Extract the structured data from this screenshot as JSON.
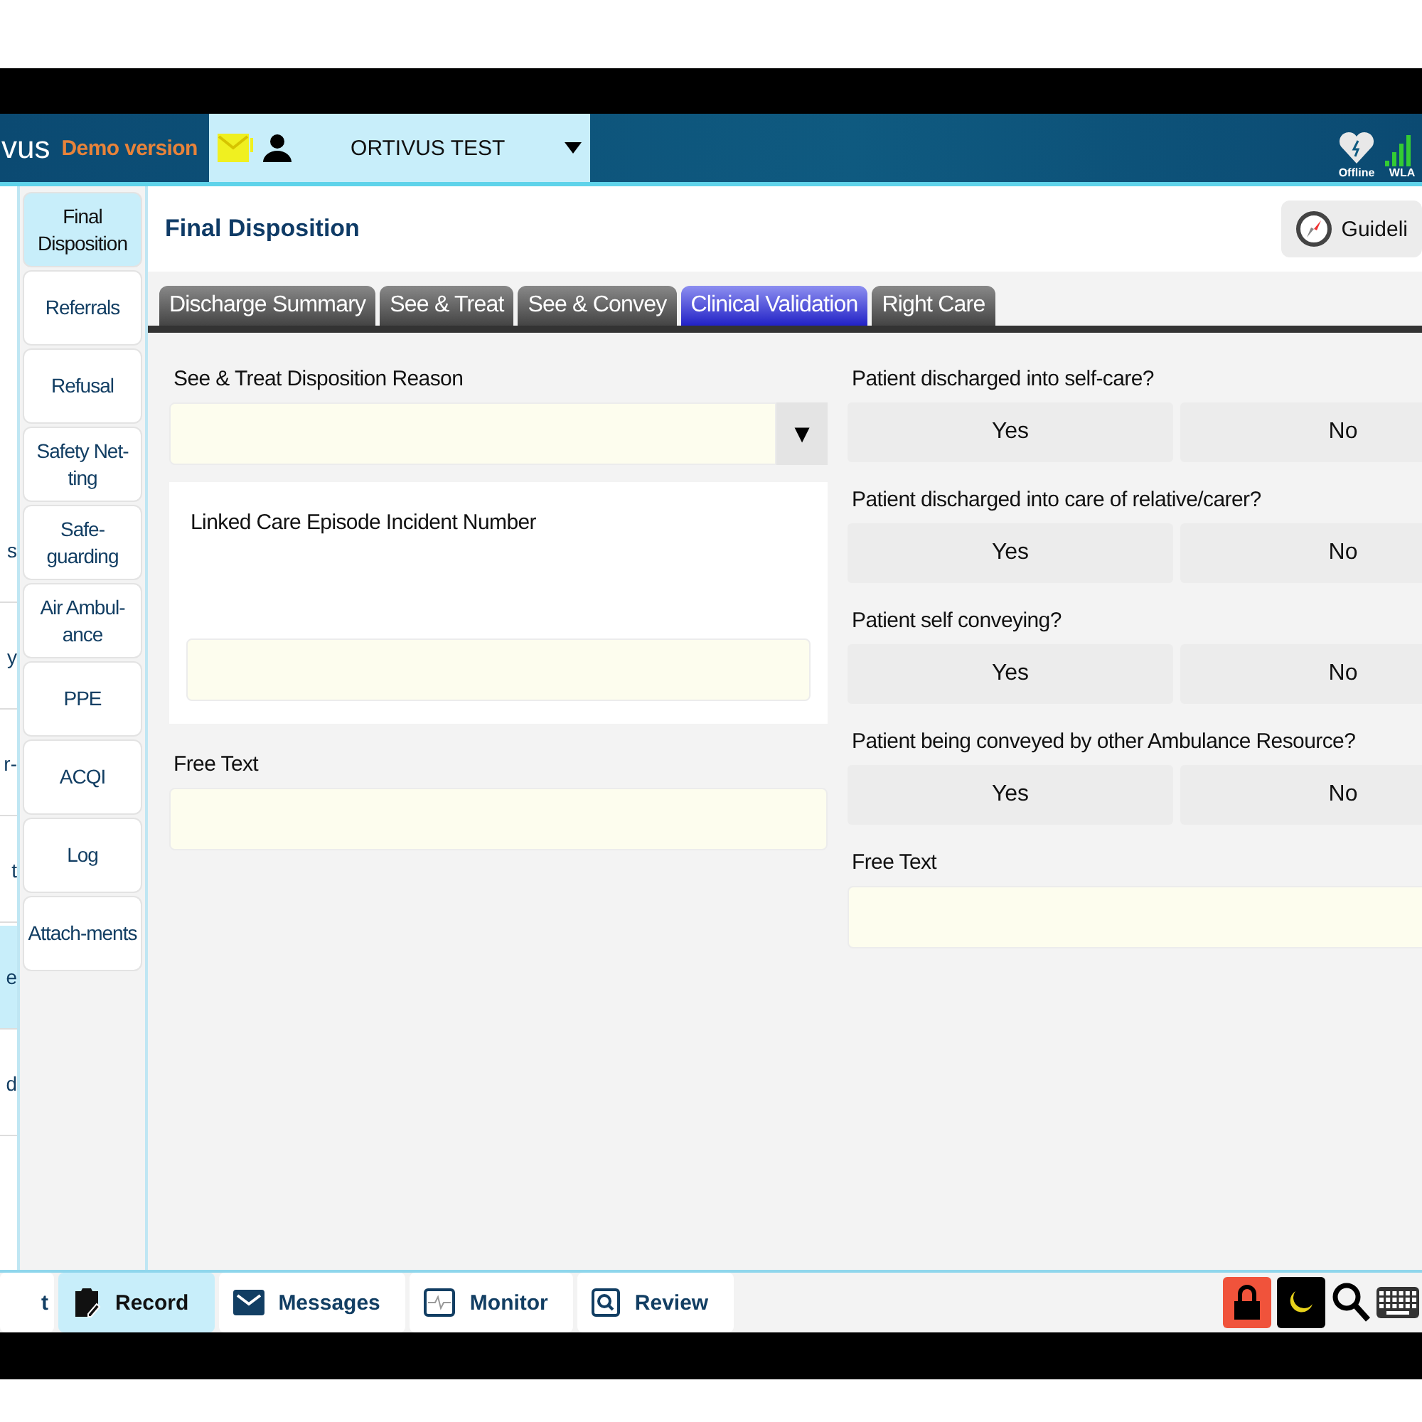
{
  "header": {
    "logo": "vus",
    "demo_label": "Demo version",
    "user": "ORTIVUS TEST",
    "status": [
      {
        "kind": "heart",
        "label": "Offline"
      },
      {
        "kind": "signal",
        "label": "WLA"
      }
    ]
  },
  "left_column": [
    {
      "label": "s",
      "selected": false
    },
    {
      "label": "y",
      "selected": false
    },
    {
      "label": "r-",
      "selected": false
    },
    {
      "label": "t",
      "selected": false
    },
    {
      "label": "e",
      "selected": true
    },
    {
      "label": "d",
      "selected": false
    }
  ],
  "sidebar": {
    "items": [
      {
        "label": "Final Disposition",
        "selected": true
      },
      {
        "label": "Referrals",
        "selected": false
      },
      {
        "label": "Refusal",
        "selected": false
      },
      {
        "label": "Safety Net-ting",
        "selected": false
      },
      {
        "label": "Safe-guarding",
        "selected": false
      },
      {
        "label": "Air Ambul-ance",
        "selected": false
      },
      {
        "label": "PPE",
        "selected": false
      },
      {
        "label": "ACQI",
        "selected": false
      },
      {
        "label": "Log",
        "selected": false
      },
      {
        "label": "Attach-ments",
        "selected": false
      }
    ]
  },
  "page_title": "Final Disposition",
  "guidelines_button": "Guideli",
  "tabs": [
    {
      "label": "Discharge Summary",
      "selected": false
    },
    {
      "label": "See & Treat",
      "selected": false
    },
    {
      "label": "See & Convey",
      "selected": false
    },
    {
      "label": "Clinical Validation",
      "selected": true
    },
    {
      "label": "Right Care",
      "selected": false
    }
  ],
  "left_form": {
    "reason_label": "See & Treat Disposition Reason",
    "reason_dropdown": "▼",
    "incident_label": "Linked Care Episode Incident Number",
    "free_text_label": "Free Text"
  },
  "questions": [
    {
      "label": "Patient discharged into self-care?",
      "options": [
        {
          "label": "Yes",
          "selected": false
        },
        {
          "label": "No",
          "selected": false
        }
      ]
    },
    {
      "label": "Patient discharged into care of relative/carer?",
      "options": [
        {
          "label": "Yes",
          "selected": false
        },
        {
          "label": "No",
          "selected": false
        }
      ]
    },
    {
      "label": "Patient self conveying?",
      "options": [
        {
          "label": "Yes",
          "selected": false
        },
        {
          "label": "No",
          "selected": false
        }
      ]
    },
    {
      "label": "Patient being conveyed by other Ambulance Resource?",
      "options": [
        {
          "label": "Yes",
          "selected": false
        },
        {
          "label": "No",
          "selected": false
        }
      ]
    }
  ],
  "right_free_text_label": "Free Text",
  "bottom_nav": [
    {
      "kind": "none",
      "label": "t",
      "selected": false
    },
    {
      "kind": "record",
      "label": "Record",
      "selected": true
    },
    {
      "kind": "messages",
      "label": "Messages",
      "selected": false
    },
    {
      "kind": "monitor",
      "label": "Monitor",
      "selected": false
    },
    {
      "kind": "review",
      "label": "Review",
      "selected": false
    }
  ],
  "tools": [
    {
      "kind": "lock"
    },
    {
      "kind": "moon"
    },
    {
      "kind": "search"
    },
    {
      "kind": "keyboard"
    }
  ]
}
